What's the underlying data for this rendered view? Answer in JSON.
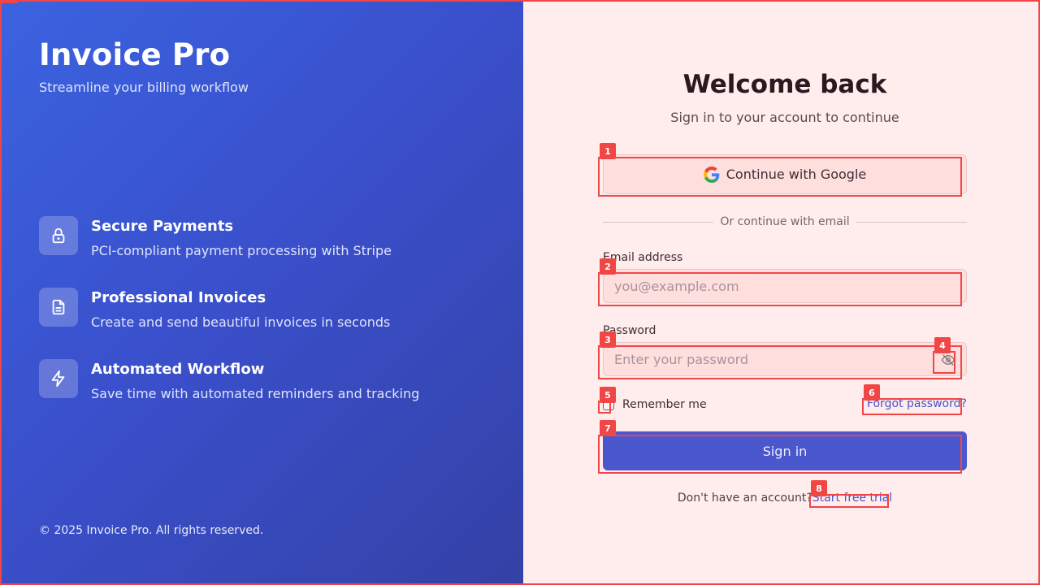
{
  "brand": {
    "title": "Invoice Pro",
    "subtitle": "Streamline your billing workflow"
  },
  "features": [
    {
      "icon": "lock-icon",
      "title": "Secure Payments",
      "description": "PCI-compliant payment processing with Stripe"
    },
    {
      "icon": "document-icon",
      "title": "Professional Invoices",
      "description": "Create and send beautiful invoices in seconds"
    },
    {
      "icon": "lightning-icon",
      "title": "Automated Workflow",
      "description": "Save time with automated reminders and tracking"
    }
  ],
  "footer": "© 2025 Invoice Pro. All rights reserved.",
  "login": {
    "title": "Welcome back",
    "subtitle": "Sign in to your account to continue",
    "google_label": "Continue with Google",
    "divider_text": "Or continue with email",
    "email_label": "Email address",
    "email_placeholder": "you@example.com",
    "password_label": "Password",
    "password_placeholder": "Enter your password",
    "remember_label": "Remember me",
    "forgot_label": "Forgot password?",
    "signin_label": "Sign in",
    "signup_prompt": "Don't have an account?",
    "signup_link": "Start free trial"
  },
  "marks": [
    "1",
    "2",
    "3",
    "4",
    "5",
    "6",
    "7",
    "8"
  ],
  "colors": {
    "accent": "#4b57cc",
    "panel_gradient_start": "#3b63e0",
    "panel_gradient_end": "#3441a6",
    "page_background": "#ffecec",
    "annotation": "#f04646"
  }
}
